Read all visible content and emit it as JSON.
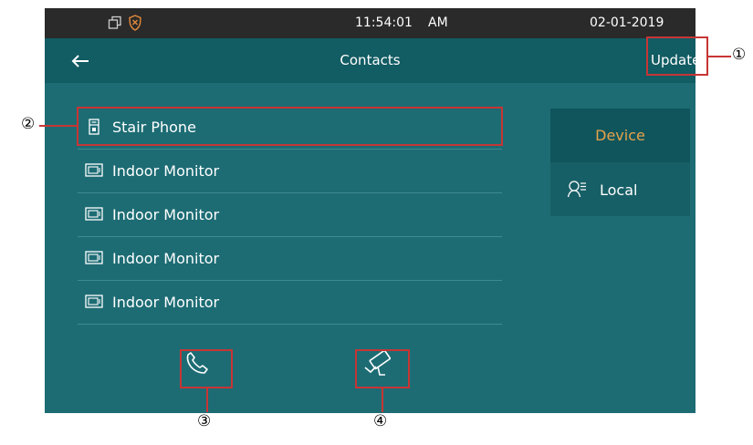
{
  "status_bar": {
    "time": "11:54:01",
    "ampm": "AM",
    "date": "02-01-2019",
    "icons": [
      "multi-window-icon",
      "shield-icon"
    ]
  },
  "header": {
    "title": "Contacts",
    "back_icon": "arrow-left-icon",
    "update_label": "Update"
  },
  "contacts": [
    {
      "label": "Stair Phone",
      "icon": "stair-phone-icon",
      "selected": true
    },
    {
      "label": "Indoor Monitor",
      "icon": "monitor-icon"
    },
    {
      "label": "Indoor Monitor",
      "icon": "monitor-icon"
    },
    {
      "label": "Indoor Monitor",
      "icon": "monitor-icon"
    },
    {
      "label": "Indoor Monitor",
      "icon": "monitor-icon"
    }
  ],
  "side_tabs": {
    "device_label": "Device",
    "local_label": "Local",
    "local_icon": "contacts-list-icon"
  },
  "bottom_actions": {
    "call_icon": "phone-icon",
    "monitor_icon": "camera-icon"
  },
  "callouts": {
    "c1": "①",
    "c2": "②",
    "c3": "③",
    "c4": "④"
  },
  "colors": {
    "screen_bg": "#1d6c74",
    "header_bg": "#125c63",
    "statusbar_bg": "#2a2a2a",
    "accent_active": "#e7a24a",
    "highlight_box": "#c73535"
  }
}
